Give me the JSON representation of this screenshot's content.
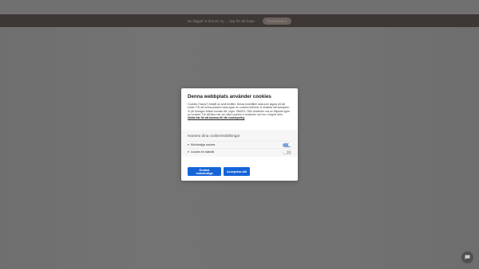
{
  "topbar": {
    "text": "Nu lägger vi hos en ny ... nyp för att kopa",
    "button_label": "Prenumerera"
  },
  "cookie_modal": {
    "title": "Denna webbplats använder cookies",
    "body": "Cookies (”kakor”) består av små textfiler. Dessa innehåller data som lagras på din enhet. För att kunna placera vissa typer av cookies behöver vi inhämta ditt samtycke. Vi på Sveriges Möbel-Industri AB, orgnr. 556201-7382 använder oss av följande typer av cookies. För att läsa mer om vilka cookies vi använder och hur vi lagrar dem,",
    "link_text": "klicka här för att komma till vår cookiepolicy",
    "settings_title": "Hantera dina cookieinställningar",
    "settings": [
      {
        "label": "Nödvändiga cookies",
        "enabled": true
      },
      {
        "label": "Cookies för statistik",
        "enabled": false
      }
    ],
    "btn_necessary": "Endast nödvändiga",
    "btn_accept": "Acceptera allt"
  },
  "colors": {
    "primary": "#1565d8",
    "overlay": "#707070",
    "topbar": "#3d3736"
  },
  "chat_icon": "chat-bubble-icon"
}
